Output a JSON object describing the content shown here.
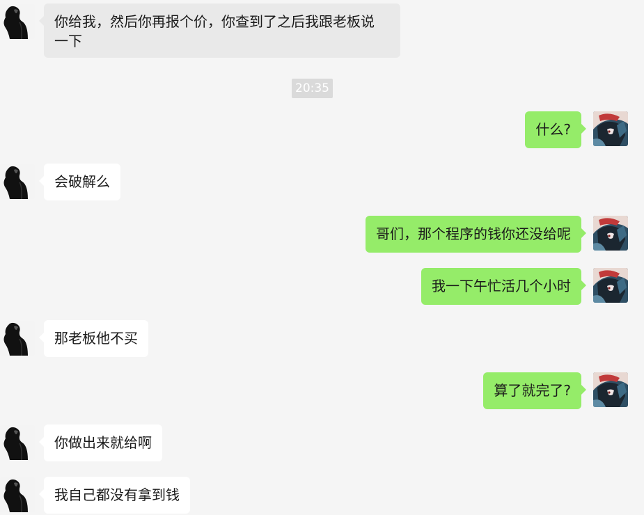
{
  "messages": [
    {
      "side": "in",
      "text": "你给我，然后你再报个价，你查到了之后我跟老板说\n一下",
      "highlighted": true
    },
    {
      "side": "out",
      "text": "什么?"
    },
    {
      "side": "in",
      "text": "会破解么"
    },
    {
      "side": "out",
      "text": "哥们，那个程序的钱你还没给呢"
    },
    {
      "side": "out",
      "text": "我一下午忙活几个小时"
    },
    {
      "side": "in",
      "text": "那老板他不买"
    },
    {
      "side": "out",
      "text": "算了就完了?"
    },
    {
      "side": "in",
      "text": "你做出来就给啊"
    },
    {
      "side": "in",
      "text": "我自己都没有拿到钱"
    }
  ],
  "timestamp": "20:35",
  "colors": {
    "background": "#f5f5f5",
    "incoming_bubble": "#ffffff",
    "outgoing_bubble": "#95ec69",
    "timestamp_bg": "#dadada"
  },
  "icons": {
    "contact_avatar": "dark-silhouette-avatar",
    "self_avatar": "anime-character-avatar"
  }
}
